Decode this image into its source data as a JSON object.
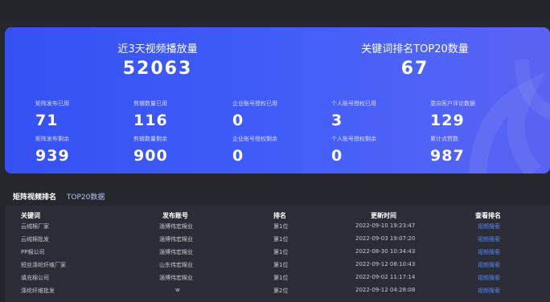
{
  "hero": {
    "big": [
      {
        "label": "近3天视频播放量",
        "value": "52063"
      },
      {
        "label": "关键词排名TOP20数量",
        "value": "67"
      }
    ],
    "stats_row1": [
      {
        "label": "矩阵发布已用",
        "value": "71"
      },
      {
        "label": "剪辑数量已用",
        "value": "116"
      },
      {
        "label": "企业账号授权已用",
        "value": "0"
      },
      {
        "label": "个人账号授权已用",
        "value": "3"
      },
      {
        "label": "意向客户评论数据",
        "value": "129"
      }
    ],
    "stats_row2": [
      {
        "label": "矩阵发布剩余",
        "value": "939"
      },
      {
        "label": "剪辑数量剩余",
        "value": "900"
      },
      {
        "label": "企业账号授权剩余",
        "value": "0"
      },
      {
        "label": "个人账号授权剩余",
        "value": "0"
      },
      {
        "label": "累计点赞数",
        "value": "987"
      }
    ]
  },
  "tabs": [
    {
      "label": "矩阵视频排名"
    },
    {
      "label": "TOP20数据"
    }
  ],
  "table": {
    "headers": [
      "关键词",
      "发布账号",
      "排名",
      "更新时间",
      "查看排名"
    ],
    "rows": [
      [
        "云绒棉厂家",
        "淄博伟宏棉业",
        "第1位",
        "2022-09-10 19:23:47",
        "视频搜索"
      ],
      [
        "云绒棉批发",
        "淄博伟宏棉业",
        "第1位",
        "2022-09-03 19:07:20",
        "视频搜索"
      ],
      [
        "PP棉公司",
        "淄博伟宏棉业",
        "第1位",
        "2022-08-30 10:34:43",
        "视频搜索"
      ],
      [
        "短丝涤纶纤维厂家",
        "山东伟宏棉业",
        "第1位",
        "2022-09-12 08:10:43",
        "视频搜索"
      ],
      [
        "填充棉公司",
        "淄博伟宏棉业",
        "第1位",
        "2022-09-02 11:17:14",
        "视频搜索"
      ],
      [
        "涤纶纤维批发",
        "w",
        "第2位",
        "2022-09-12 04:28:08",
        "视频搜索"
      ]
    ]
  }
}
